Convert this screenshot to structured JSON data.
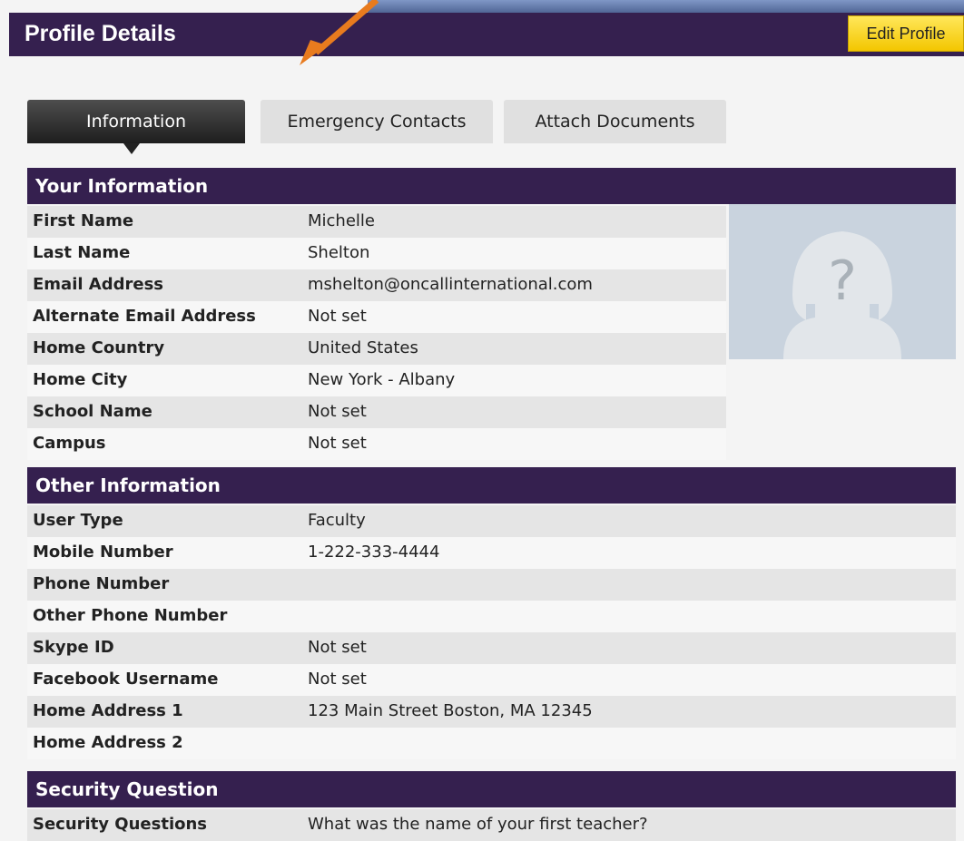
{
  "header": {
    "title": "Profile Details",
    "edit_button": "Edit Profile"
  },
  "tabs": [
    {
      "label": "Information",
      "active": true
    },
    {
      "label": "Emergency Contacts",
      "active": false
    },
    {
      "label": "Attach Documents",
      "active": false
    }
  ],
  "your_information": {
    "title": "Your Information",
    "rows": [
      {
        "label": "First Name",
        "value": "Michelle"
      },
      {
        "label": "Last Name",
        "value": "Shelton"
      },
      {
        "label": "Email Address",
        "value": "mshelton@oncallinternational.com"
      },
      {
        "label": "Alternate Email Address",
        "value": "Not set"
      },
      {
        "label": "Home Country",
        "value": "United States"
      },
      {
        "label": "Home City",
        "value": "New York - Albany"
      },
      {
        "label": "School Name",
        "value": "Not set"
      },
      {
        "label": "Campus",
        "value": "Not set"
      }
    ]
  },
  "other_information": {
    "title": "Other Information",
    "rows": [
      {
        "label": "User Type",
        "value": "Faculty"
      },
      {
        "label": "Mobile Number",
        "value": "1-222-333-4444"
      },
      {
        "label": "Phone Number",
        "value": ""
      },
      {
        "label": "Other Phone Number",
        "value": ""
      },
      {
        "label": "Skype ID",
        "value": "Not set"
      },
      {
        "label": "Facebook Username",
        "value": "Not set"
      },
      {
        "label": "Home Address 1",
        "value": "123 Main Street Boston, MA 12345"
      },
      {
        "label": "Home Address 2",
        "value": ""
      }
    ]
  },
  "security_question": {
    "title": "Security Question",
    "rows": [
      {
        "label": "Security Questions",
        "value": "What was the name of your first teacher?"
      }
    ]
  },
  "icons": {
    "avatar": "avatar-placeholder-icon",
    "arrow": "annotation-arrow-icon"
  },
  "colors": {
    "header": "#35204f",
    "edit_button": "#f7d21a",
    "active_tab": "#2e2e2e"
  }
}
